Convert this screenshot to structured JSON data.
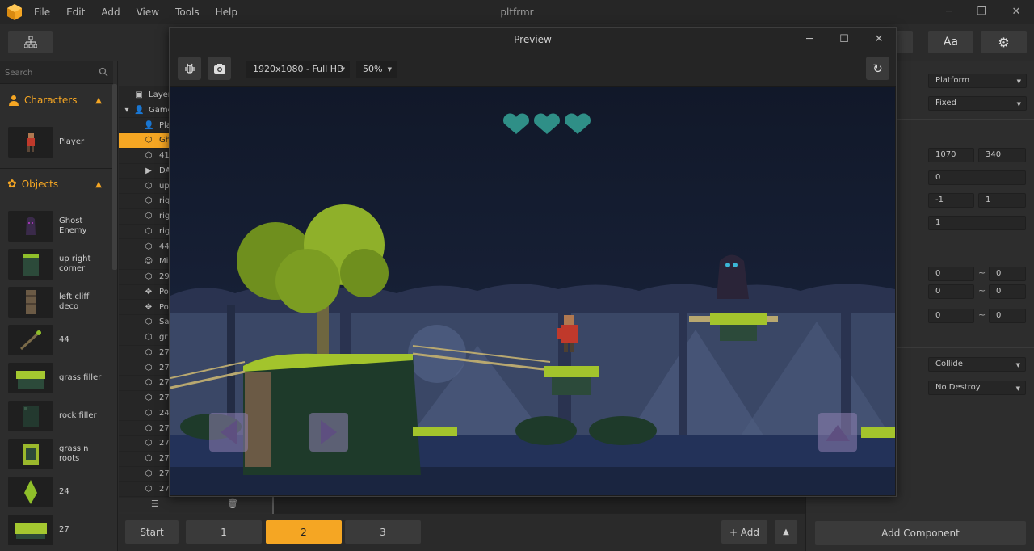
{
  "app": {
    "title": "pltfrmr",
    "menu": [
      "File",
      "Edit",
      "Add",
      "View",
      "Tools",
      "Help"
    ]
  },
  "toolbar": {
    "font_label": "Aa"
  },
  "left_panel": {
    "search_placeholder": "Search",
    "characters_label": "Characters",
    "objects_label": "Objects",
    "characters": [
      "Player"
    ],
    "objects": [
      "Ghost\nEnemy",
      "up right\ncorner",
      "left cliff\ndeco",
      "44",
      "grass filler",
      "rock filler",
      "grass n\nroots",
      "24",
      "27"
    ]
  },
  "layers": {
    "rows": [
      {
        "icon": "layer-icon",
        "text": "Layer",
        "indent": 1
      },
      {
        "icon": "game-icon",
        "text": "Game",
        "indent": 1
      },
      {
        "icon": "person-icon",
        "text": "Pla",
        "indent": 2
      },
      {
        "icon": "hex-icon",
        "text": "Gh",
        "indent": 2,
        "selected": true
      },
      {
        "icon": "hex-icon",
        "text": "41",
        "indent": 2
      },
      {
        "icon": "play-icon",
        "text": "DA",
        "indent": 2
      },
      {
        "icon": "hex-icon",
        "text": "up",
        "indent": 2
      },
      {
        "icon": "hex-icon",
        "text": "rig",
        "indent": 2
      },
      {
        "icon": "hex-icon",
        "text": "rig",
        "indent": 2
      },
      {
        "icon": "hex-icon",
        "text": "rig",
        "indent": 2
      },
      {
        "icon": "hex-icon",
        "text": "44",
        "indent": 2
      },
      {
        "icon": "smile-icon",
        "text": "Mi",
        "indent": 2
      },
      {
        "icon": "hex-icon",
        "text": "29",
        "indent": 2
      },
      {
        "icon": "move-icon",
        "text": "Po",
        "indent": 2
      },
      {
        "icon": "move-icon",
        "text": "Po",
        "indent": 2
      },
      {
        "icon": "hex-icon",
        "text": "Sa",
        "indent": 2
      },
      {
        "icon": "hex-icon",
        "text": "gr",
        "indent": 2
      },
      {
        "icon": "hex-icon",
        "text": "27",
        "indent": 2
      },
      {
        "icon": "hex-icon",
        "text": "27",
        "indent": 2
      },
      {
        "icon": "hex-icon",
        "text": "27",
        "indent": 2
      },
      {
        "icon": "hex-icon",
        "text": "27",
        "indent": 2
      },
      {
        "icon": "hex-icon",
        "text": "24",
        "indent": 2
      },
      {
        "icon": "hex-icon",
        "text": "27",
        "indent": 2
      },
      {
        "icon": "hex-icon",
        "text": "27",
        "indent": 2
      },
      {
        "icon": "hex-icon",
        "text": "27",
        "indent": 2
      },
      {
        "icon": "hex-icon",
        "text": "27",
        "indent": 2
      },
      {
        "icon": "hex-icon",
        "text": "27",
        "indent": 2
      }
    ]
  },
  "bottom_bar": {
    "start": "Start",
    "scenes": [
      "1",
      "2",
      "3"
    ],
    "active_scene": "2",
    "add_label": "+ Add"
  },
  "right_panel": {
    "type_select": "Platform",
    "mode_select": "Fixed",
    "pos_x": "1070",
    "pos_y": "340",
    "rotation": "0",
    "scale_x": "-1",
    "scale_y": "1",
    "opacity": "1",
    "range1_min": "0",
    "range1_max": "0",
    "range2_min": "0",
    "range2_max": "0",
    "range3_min": "0",
    "range3_max": "0",
    "collision_select": "Collide",
    "destroy_select": "No Destroy",
    "add_component": "Add Component"
  },
  "preview": {
    "title": "Preview",
    "resolution": "1920x1080 - Full HD",
    "zoom": "50%",
    "hearts": 3
  },
  "colors": {
    "accent": "#f5a623",
    "bg": "#2b2b2b",
    "panel": "#2d2d2d"
  }
}
